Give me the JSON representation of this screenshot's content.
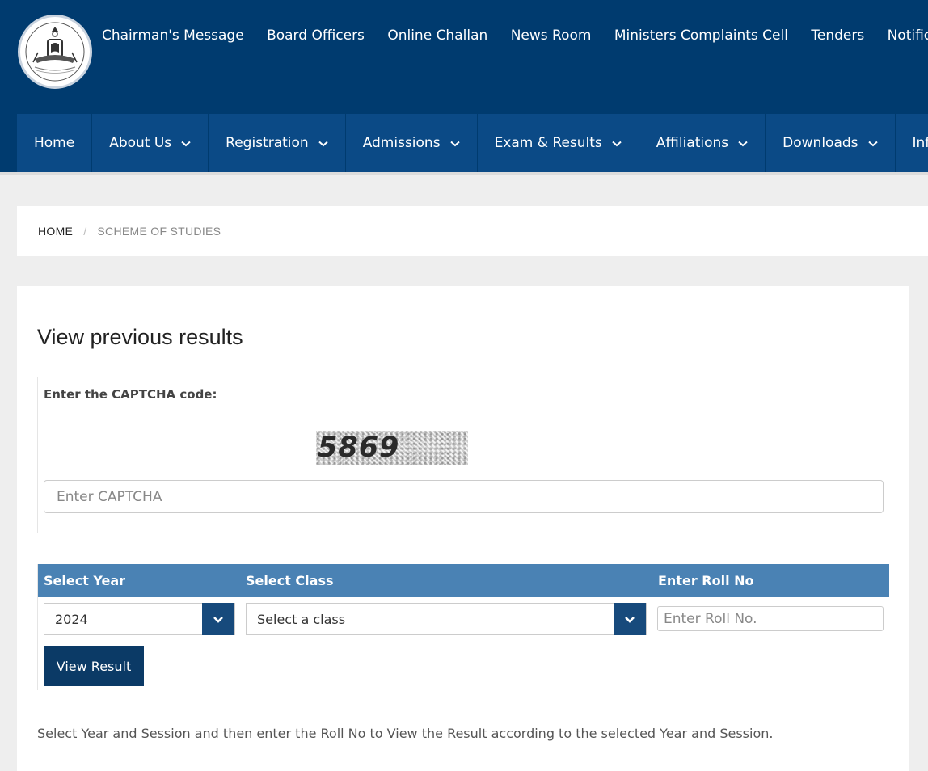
{
  "header": {
    "top_links": [
      "Chairman's Message",
      "Board Officers",
      "Online Challan",
      "News Room",
      "Ministers Complaints Cell",
      "Tenders",
      "Notification"
    ]
  },
  "nav": {
    "items": [
      {
        "label": "Home",
        "dropdown": false
      },
      {
        "label": "About Us",
        "dropdown": true
      },
      {
        "label": "Registration",
        "dropdown": true
      },
      {
        "label": "Admissions",
        "dropdown": true
      },
      {
        "label": "Exam & Results",
        "dropdown": true
      },
      {
        "label": "Affiliations",
        "dropdown": true
      },
      {
        "label": "Downloads",
        "dropdown": true
      },
      {
        "label": "Info De",
        "dropdown": false
      }
    ]
  },
  "breadcrumb": {
    "home": "HOME",
    "separator": "/",
    "current": "SCHEME OF STUDIES"
  },
  "page": {
    "title": "View previous results",
    "captcha_label": "Enter the CAPTCHA code:",
    "captcha_code": "5869",
    "captcha_placeholder": "Enter CAPTCHA",
    "table": {
      "col_year": "Select Year",
      "col_class": "Select Class",
      "col_roll": "Enter Roll No",
      "year_value": "2024",
      "class_value": "Select a class",
      "roll_placeholder": "Enter Roll No."
    },
    "view_button": "View Result",
    "note": "Select Year and Session and then enter the Roll No to View the Result according to the selected Year and Session."
  },
  "colors": {
    "header_bg": "#003b6f",
    "nav_item_bg": "#0b4a86",
    "table_header_bg": "#4a82b4",
    "button_bg": "#0b3a66"
  }
}
